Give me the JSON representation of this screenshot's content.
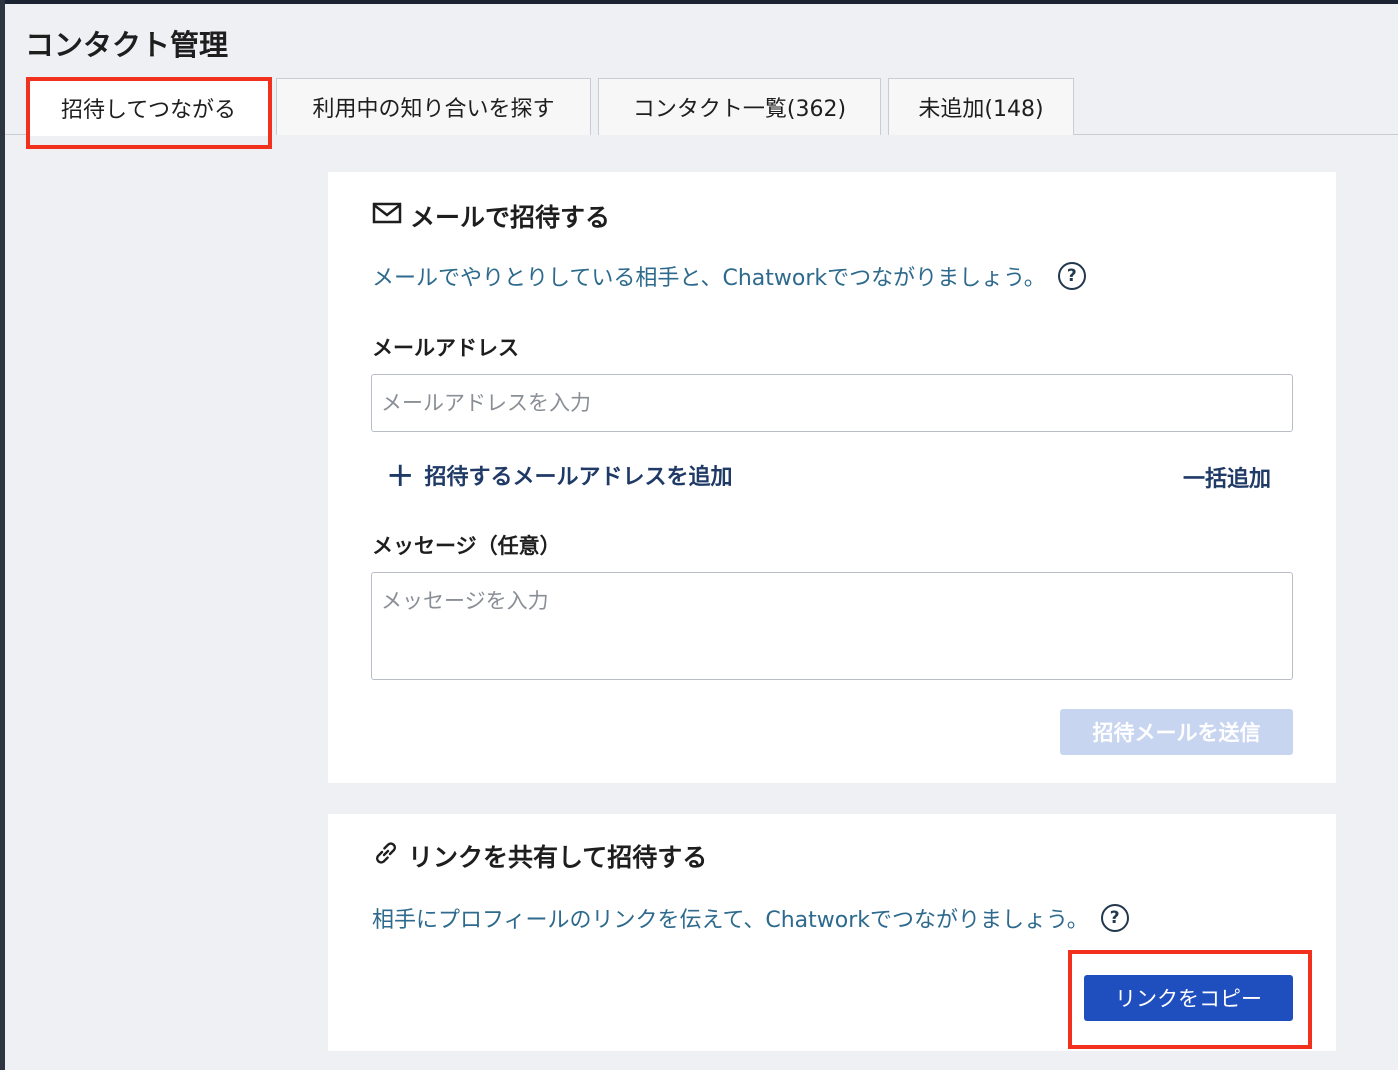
{
  "page_title": "コンタクト管理",
  "tabs": [
    {
      "label": "招待してつながる",
      "active": true
    },
    {
      "label": "利用中の知り合いを探す",
      "active": false
    },
    {
      "label": "コンタクト一覧(362)",
      "active": false
    },
    {
      "label": "未追加(148)",
      "active": false
    }
  ],
  "email_invite": {
    "title": "メールで招待する",
    "icon": "envelope-icon",
    "description": "メールでやりとりしている相手と、Chatworkでつながりましょう。",
    "help_icon": "question-circle-icon",
    "email_label": "メールアドレス",
    "email_placeholder": "メールアドレスを入力",
    "email_value": "",
    "add_email_label": "招待するメールアドレスを追加",
    "bulk_add_label": "一括追加",
    "message_label": "メッセージ（任意）",
    "message_placeholder": "メッセージを入力",
    "message_value": "",
    "send_button_label": "招待メールを送信",
    "send_button_enabled": false
  },
  "link_invite": {
    "title": "リンクを共有して招待する",
    "icon": "link-icon",
    "description": "相手にプロフィールのリンクを伝えて、Chatworkでつながりましょう。",
    "help_icon": "question-circle-icon",
    "copy_button_label": "リンクをコピー"
  },
  "colors": {
    "highlight": "#f1311e",
    "primary_button": "#1f4fbf",
    "disabled_button": "#c8d5f0",
    "description_text": "#2d6a8d",
    "link_action": "#1f3a66"
  }
}
